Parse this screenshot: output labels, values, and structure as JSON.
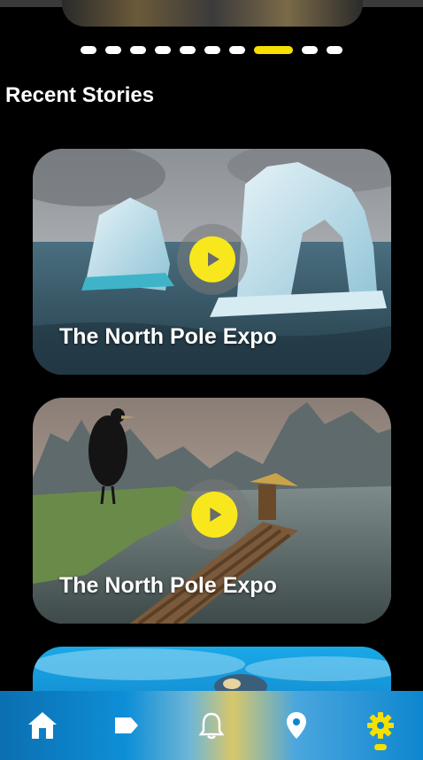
{
  "carousel": {
    "total_slides": 10,
    "active_index": 7
  },
  "section": {
    "title": "Recent Stories"
  },
  "stories": [
    {
      "title": "The North Pole Expo",
      "scene": "iceberg"
    },
    {
      "title": "The North Pole Expo",
      "scene": "river-fisherman"
    },
    {
      "title": "",
      "scene": "underwater"
    }
  ],
  "icons": {
    "play": "play-icon"
  },
  "nav": {
    "items": [
      {
        "name": "home-icon",
        "active": false
      },
      {
        "name": "tag-icon",
        "active": false
      },
      {
        "name": "bell-icon",
        "active": false
      },
      {
        "name": "location-pin-icon",
        "active": false
      },
      {
        "name": "gear-icon",
        "active": true
      }
    ]
  },
  "colors": {
    "accent": "#f5e000",
    "background": "#000000",
    "nav_blue": "#0d86cf"
  }
}
